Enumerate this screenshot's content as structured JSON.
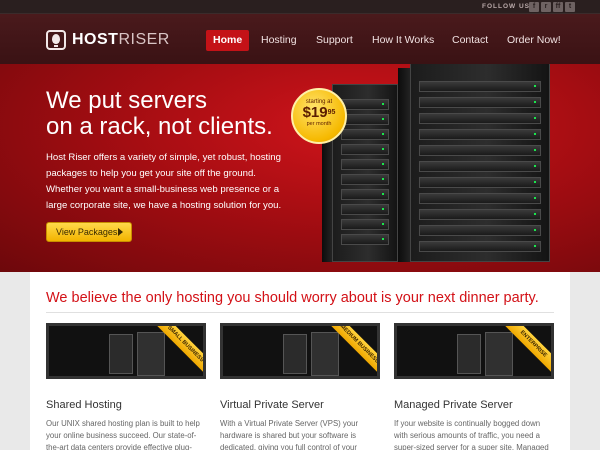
{
  "top": {
    "follow_label": "FOLLOW US",
    "social": [
      {
        "icon": "facebook-icon",
        "glyph": "f"
      },
      {
        "icon": "rss-icon",
        "glyph": "r"
      },
      {
        "icon": "friendfeed-icon",
        "glyph": "ff"
      },
      {
        "icon": "twitter-icon",
        "glyph": "t"
      }
    ]
  },
  "brand": {
    "name_a": "HOST",
    "name_b": "RISER"
  },
  "nav": [
    "Home",
    "Hosting",
    "Support",
    "How It Works",
    "Contact",
    "Order Now!"
  ],
  "hero": {
    "title_line1": "We put servers",
    "title_line2": "on a rack, not clients.",
    "body": "Host Riser offers a variety of simple, yet robust, hosting packages to help you get your site off the ground. Whether you want a small-business web presence or a large corporate site, we have a hosting solution for you.",
    "cta": "View Packages"
  },
  "badge": {
    "starting": "starting at",
    "currency": "$",
    "price": "19",
    "cents": "95",
    "per": "per month"
  },
  "tagline": "We believe the only hosting you should worry about is your next dinner party.",
  "columns": [
    {
      "ribbon": "SMALL BUSINESS",
      "title": "Shared Hosting",
      "text": "Our UNIX shared hosting plan is built to help your online business succeed. Our state-of-the-art data centers provide effective plug-and-play web"
    },
    {
      "ribbon": "MEDIUM BUSINESS",
      "title": "Virtual Private Server",
      "text": "With a Virtual Private Server (VPS) your hardware is shared but your software is dedicated, giving you full control of your website. VPS is an ideal solution that"
    },
    {
      "ribbon": "ENTERPRISE",
      "title": "Managed Private Server",
      "text": "If your website is continually bogged down with serious amounts of traffic, you need a super-sized server for a super site. Managed Private Servers"
    }
  ],
  "colors": {
    "brand_red": "#c41217",
    "accent_yellow": "#f3b400",
    "dark": "#3a1214"
  }
}
